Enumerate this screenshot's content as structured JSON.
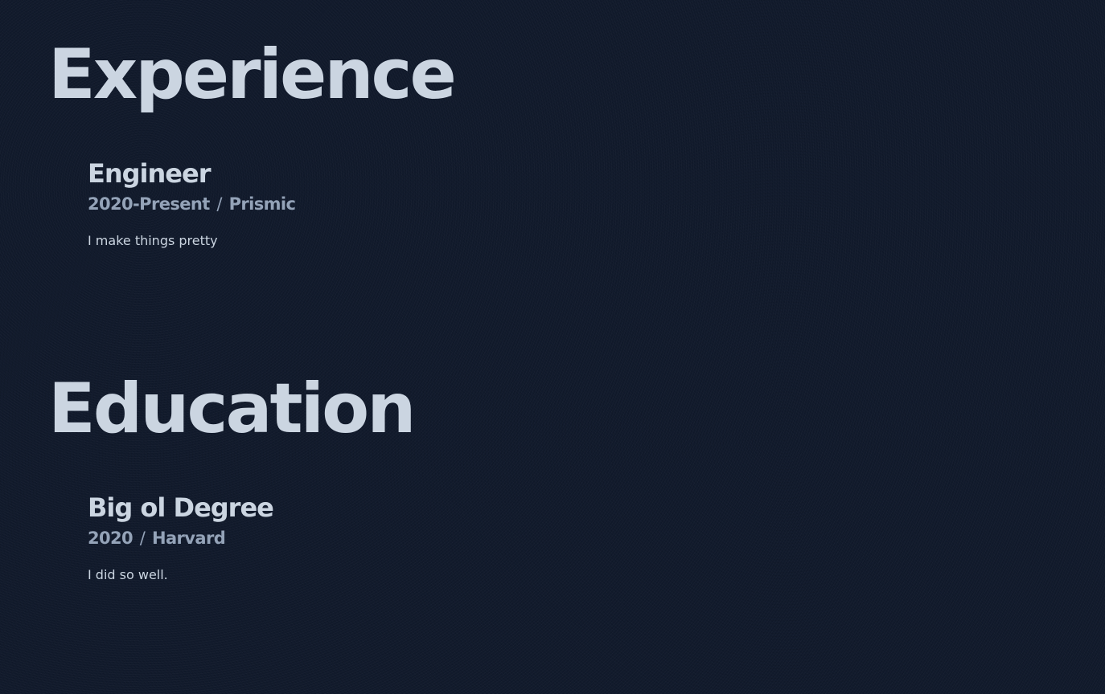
{
  "experience": {
    "title": "Experience",
    "items": [
      {
        "role": "Engineer",
        "period": "2020-Present",
        "separator": "/",
        "organization": "Prismic",
        "description": "I make things pretty"
      }
    ]
  },
  "education": {
    "title": "Education",
    "items": [
      {
        "role": "Big ol Degree",
        "period": "2020",
        "separator": "/",
        "organization": "Harvard",
        "description": "I did so well."
      }
    ]
  },
  "colors": {
    "background": "#111a2c",
    "heading": "#cbd5e1",
    "meta": "#94a3b8"
  }
}
